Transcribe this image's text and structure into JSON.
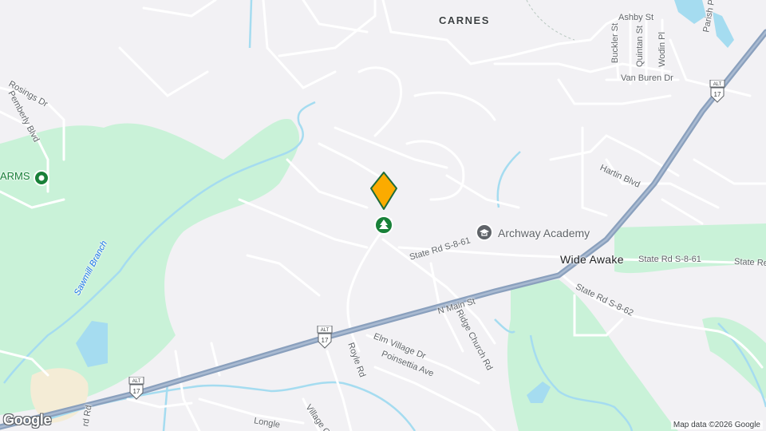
{
  "map": {
    "attribution": "Map data ©2026 Google",
    "logo": "Google",
    "colors": {
      "background": "#f2f1f4",
      "park": "#c9f2d8",
      "water": "#a5dcf0",
      "highway": "#8aa0bd",
      "road": "#ffffff",
      "sand": "#f4ecd6",
      "marker": "#fbab00",
      "poi_green": "#188038",
      "school": "#5f6368"
    },
    "places": {
      "carnes": "CARNES",
      "wide_awake": "Wide Awake",
      "arms": "ARMS",
      "archway": "Archway Academy"
    },
    "streets": {
      "ashby": "Ashby St",
      "buckler": "Buckler St",
      "quintan": "Quintan St",
      "wodin": "Wodin Pl",
      "van_buren": "Van Buren Dr",
      "parish": "Parish P",
      "rosings": "Rosings Dr",
      "pemberly": "Pemberly Blvd",
      "hartin": "Hartin Blvd",
      "state_861_a": "State Rd S-8-61",
      "state_861_b": "State Rd S-8-61",
      "state_861_c": "State Re",
      "state_862": "State Rd S-8-62",
      "main": "N Main St",
      "ridge_church": "Ridge Church Rd",
      "elm_village": "Elm Village Dr",
      "poinsettia": "Poinsettia Ave",
      "royle": "Royle Rd",
      "longlea": "Longle",
      "village": "Village C",
      "rd_left": "rd Rd",
      "sawmill": "Sawmill Branch"
    },
    "shields": {
      "alt": "ALT",
      "route": "17"
    },
    "marker": {
      "label": "selected-location"
    }
  }
}
